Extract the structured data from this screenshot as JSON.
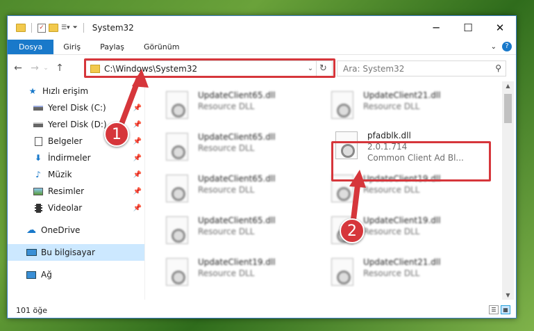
{
  "window": {
    "title": "System32"
  },
  "ribbon": {
    "tabs": [
      "Dosya",
      "Giriş",
      "Paylaş",
      "Görünüm"
    ]
  },
  "address": {
    "path": "C:\\Windows\\System32",
    "search_placeholder": "Ara: System32"
  },
  "sidebar": {
    "items": [
      {
        "label": "Hızlı erişim",
        "icon": "star-icon",
        "pinned": false
      },
      {
        "label": "Yerel Disk (C:)",
        "icon": "drive-icon",
        "pinned": true
      },
      {
        "label": "Yerel Disk (D:)",
        "icon": "drive-icon",
        "pinned": true
      },
      {
        "label": "Belgeler",
        "icon": "documents-icon",
        "pinned": true
      },
      {
        "label": "İndirmeler",
        "icon": "download-icon",
        "pinned": true
      },
      {
        "label": "Müzik",
        "icon": "music-icon",
        "pinned": true
      },
      {
        "label": "Resimler",
        "icon": "pictures-icon",
        "pinned": true
      },
      {
        "label": "Videolar",
        "icon": "video-icon",
        "pinned": true
      },
      {
        "label": "OneDrive",
        "icon": "cloud-icon",
        "pinned": false
      },
      {
        "label": "Bu bilgisayar",
        "icon": "computer-icon",
        "pinned": false
      },
      {
        "label": "Ağ",
        "icon": "network-icon",
        "pinned": false
      }
    ]
  },
  "files": {
    "left": [
      {
        "name": "UpdateClient65.dll",
        "desc": "Resource DLL"
      },
      {
        "name": "UpdateClient65.dll",
        "desc": "Resource DLL"
      },
      {
        "name": "UpdateClient65.dll",
        "desc": "Resource DLL"
      },
      {
        "name": "UpdateClient65.dll",
        "desc": "Resource DLL"
      },
      {
        "name": "UpdateClient19.dll",
        "desc": "Resource DLL"
      }
    ],
    "right": [
      {
        "name": "UpdateClient21.dll",
        "desc": "Resource DLL"
      },
      {
        "name": "pfadblk.dll",
        "desc": "2.0.1.714",
        "desc2": "Common Client Ad Bl..."
      },
      {
        "name": "UpdateClient19.dll",
        "desc": "Resource DLL"
      },
      {
        "name": "UpdateClient19.dll",
        "desc": "Resource DLL"
      },
      {
        "name": "UpdateClient21.dll",
        "desc": "Resource DLL"
      }
    ]
  },
  "status": {
    "count": "101 öğe"
  },
  "callouts": {
    "one": "1",
    "two": "2"
  },
  "colors": {
    "accent": "#1979ca",
    "highlight": "#d6363b",
    "selection": "#cce8ff"
  }
}
